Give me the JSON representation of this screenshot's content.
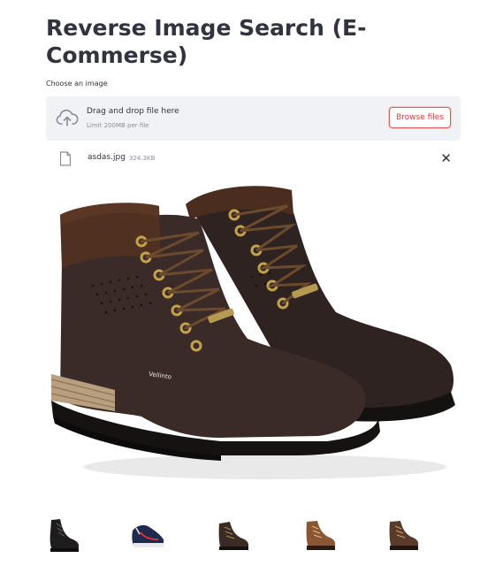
{
  "page": {
    "title": "Reverse Image Search (E-Commerse)"
  },
  "uploader": {
    "label": "Choose an image",
    "drop_text": "Drag and drop file here",
    "limit_text": "Limit 200MB per file",
    "browse_label": "Browse files",
    "file": {
      "name": "asdas.jpg",
      "size": "324.3KB"
    },
    "remove_glyph": "✕"
  },
  "results": {
    "thumbnails": [
      {
        "name": "black-boot"
      },
      {
        "name": "navy-sneaker"
      },
      {
        "name": "dark-brown-boot"
      },
      {
        "name": "tan-boot"
      },
      {
        "name": "brown-boot"
      }
    ]
  },
  "colors": {
    "accent": "#ff4b4b",
    "dropzone_bg": "#f0f2f6",
    "text": "#31333f",
    "muted": "#8a8d96"
  },
  "icons": {
    "upload": "cloud-upload-icon",
    "file": "file-icon",
    "remove": "close-icon"
  }
}
